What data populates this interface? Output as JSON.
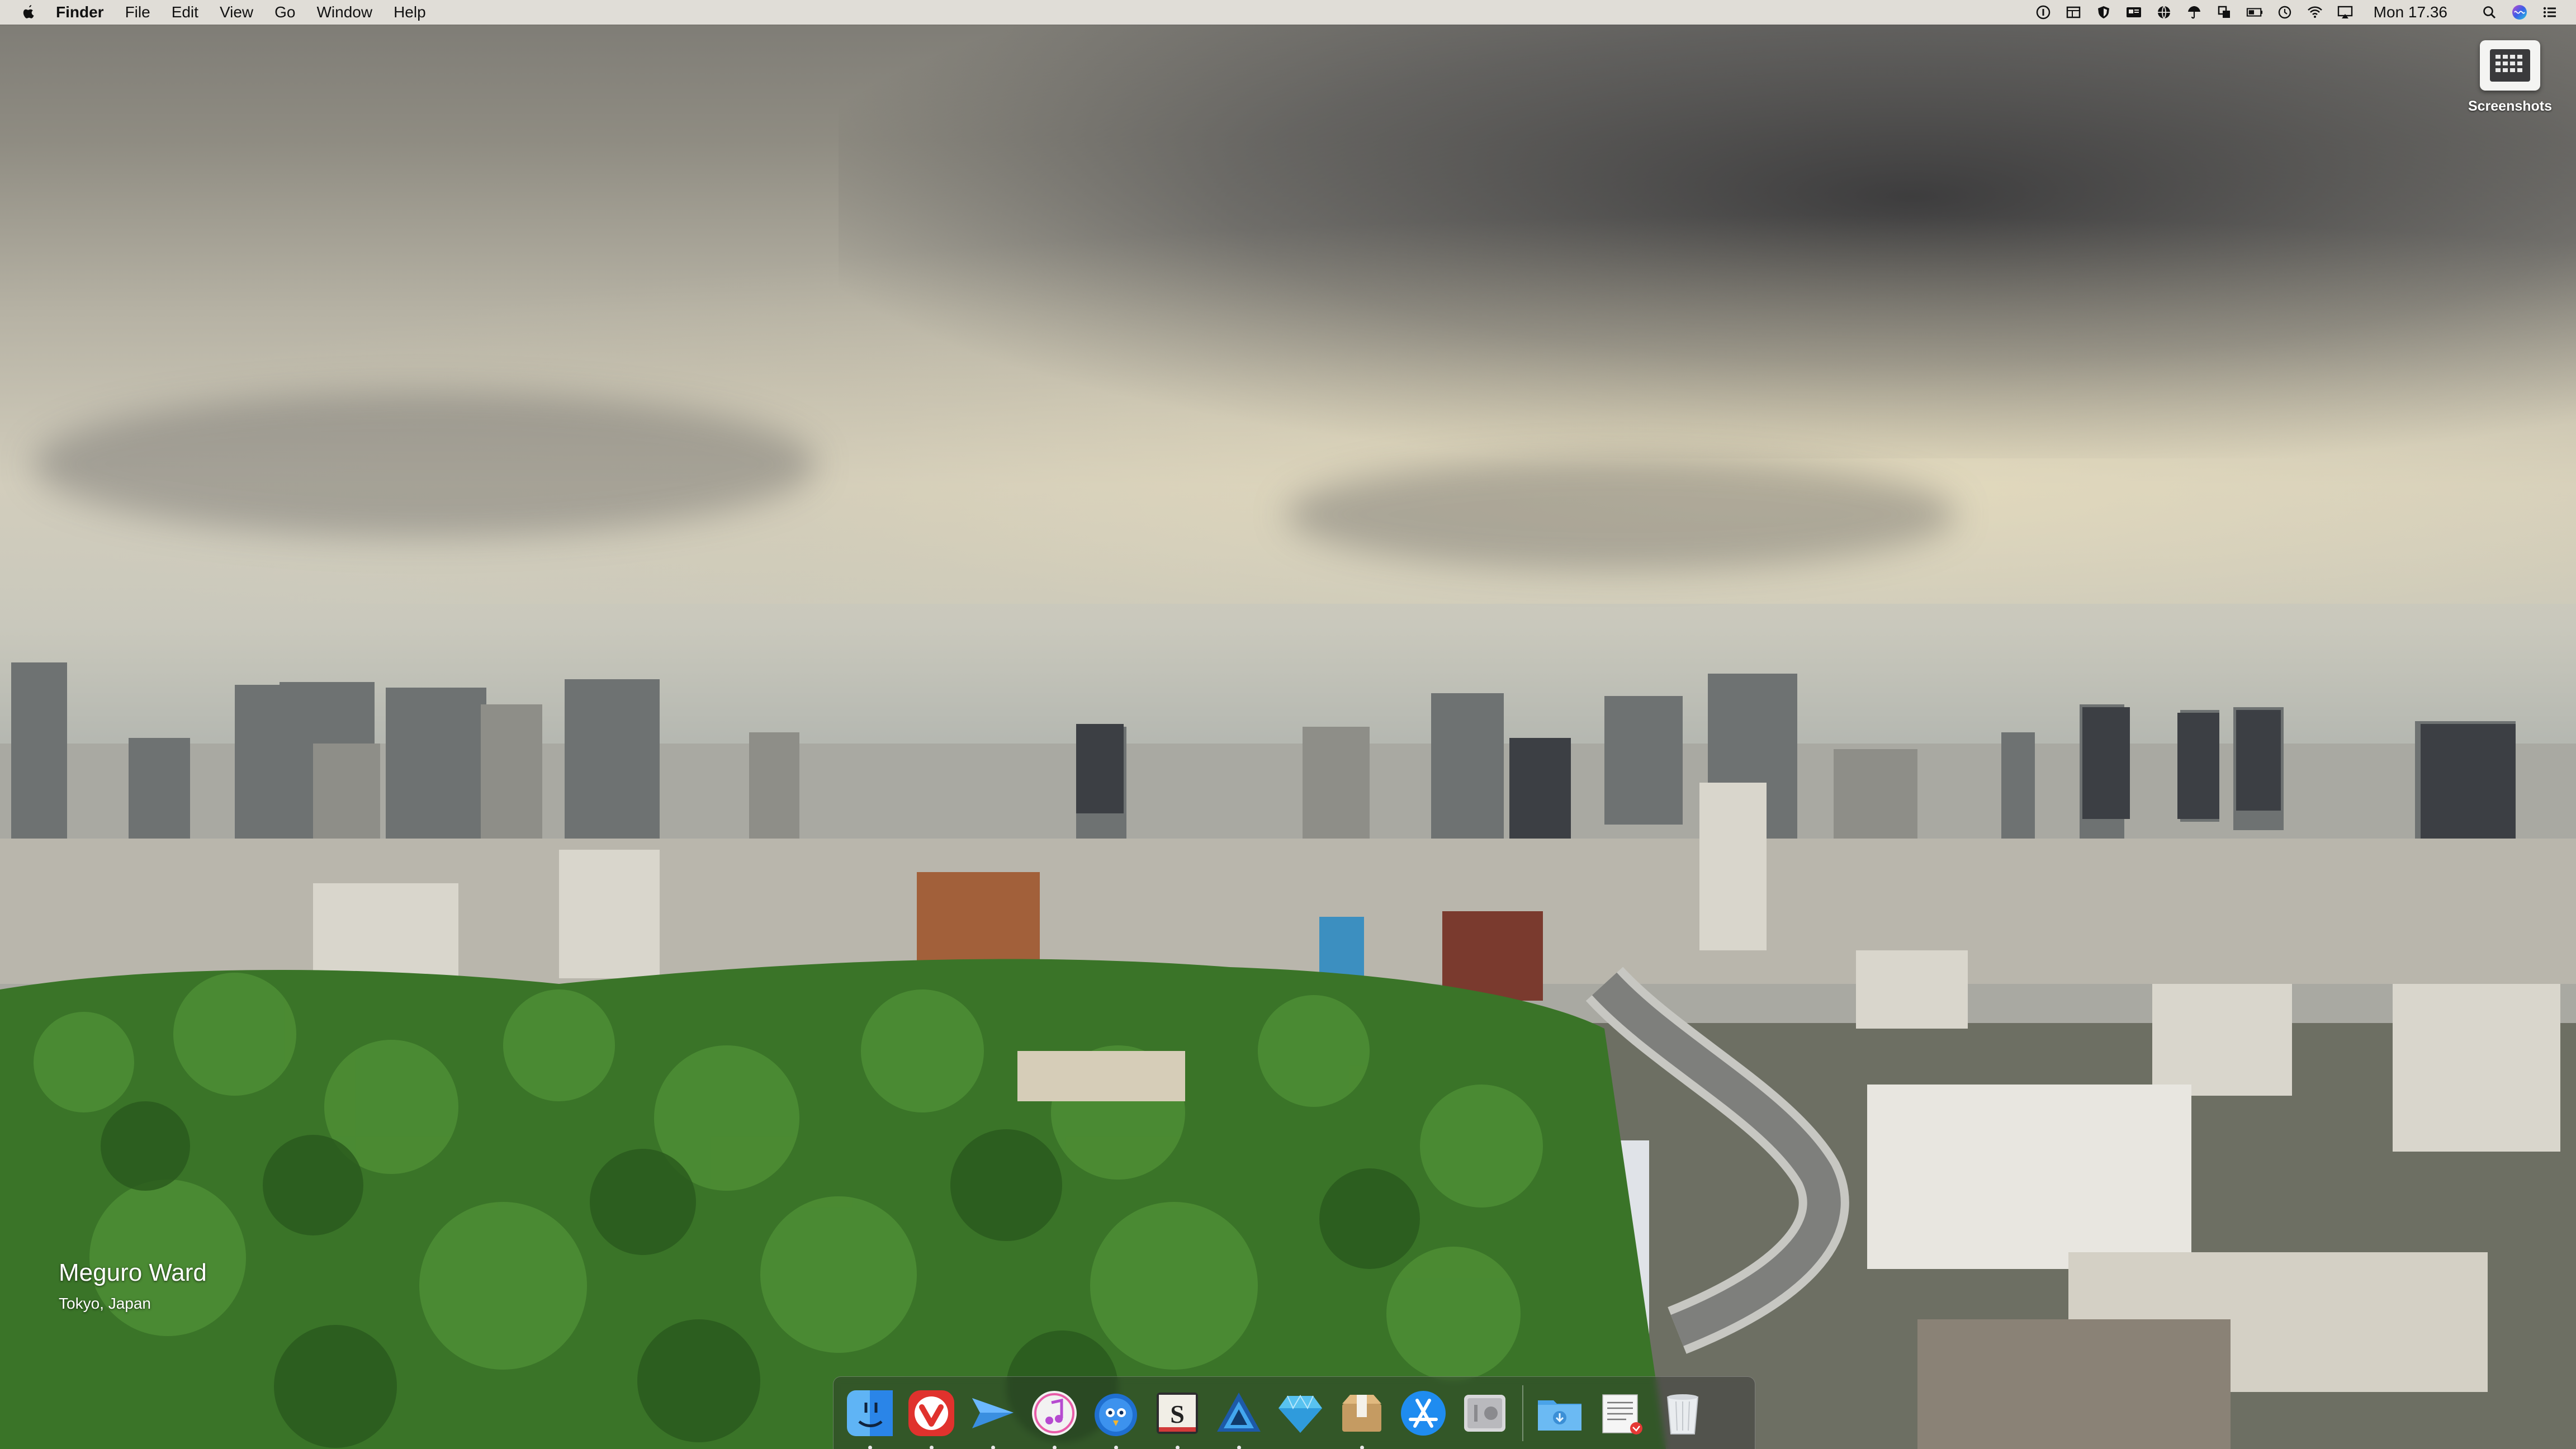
{
  "menubar": {
    "app_name": "Finder",
    "items": [
      "File",
      "Edit",
      "View",
      "Go",
      "Window",
      "Help"
    ],
    "clock": "Mon 17.36",
    "status_icons": [
      "onepassword-icon",
      "screen-layout-icon",
      "shield-icon",
      "news-icon",
      "globe-icon",
      "umbrella-icon",
      "copy-icon",
      "battery-bar-icon",
      "time-machine-icon",
      "wifi-icon",
      "airplay-icon",
      "search-icon",
      "siri-icon",
      "notification-center-icon"
    ]
  },
  "desktop": {
    "items": [
      {
        "label": "Screenshots",
        "icon": "folder-screenshots-icon"
      }
    ],
    "location": {
      "title": "Meguro Ward",
      "subtitle": "Tokyo, Japan"
    }
  },
  "dock": {
    "apps": [
      {
        "name": "finder",
        "running": true
      },
      {
        "name": "vivaldi",
        "running": true
      },
      {
        "name": "airmail",
        "running": true
      },
      {
        "name": "itunes",
        "running": true
      },
      {
        "name": "tweetbot",
        "running": true
      },
      {
        "name": "scrivener",
        "running": true
      },
      {
        "name": "affinity-designer",
        "running": true
      },
      {
        "name": "sketch",
        "running": false
      },
      {
        "name": "archiver",
        "running": true
      },
      {
        "name": "app-store",
        "running": false
      },
      {
        "name": "system-preferences",
        "running": false
      }
    ],
    "stacks": [
      {
        "name": "downloads-stack"
      },
      {
        "name": "documents-stack"
      },
      {
        "name": "trash"
      }
    ]
  },
  "colors": {
    "menubar_bg": "#e8e5e0",
    "dock_bg": "#28282a"
  }
}
